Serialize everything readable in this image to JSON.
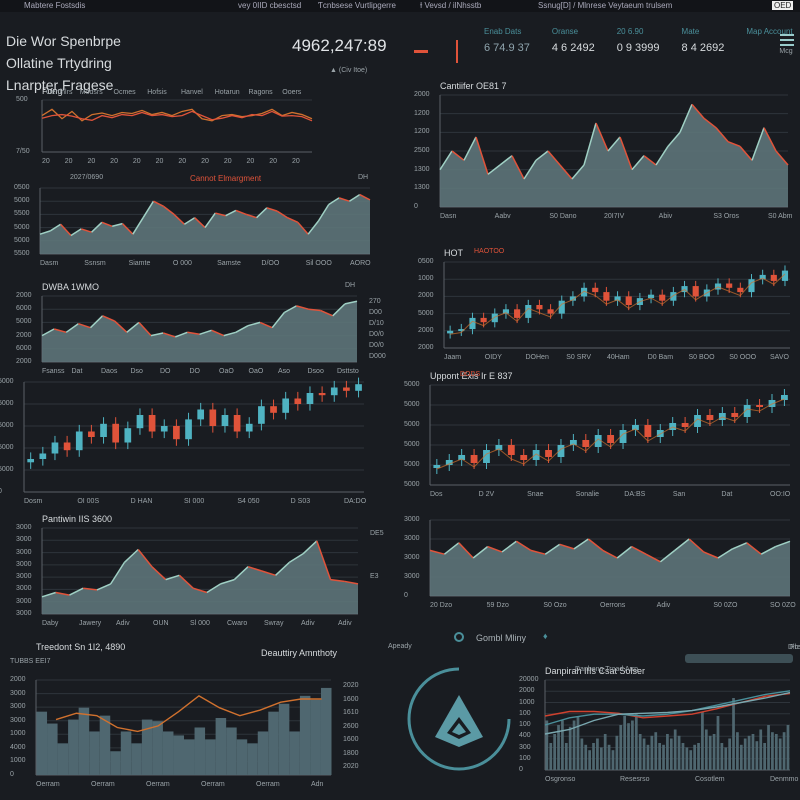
{
  "topbar": {
    "items": [
      "Mabtere Fostsdis",
      "vey 0IID cbesctsd",
      "Ƭcnbsese Vurtlipgerre",
      "Ɨ Vevsd / ilNhsstb",
      "Ssnug[D] / Mlnrese Veytaeum trulsem",
      "OED"
    ]
  },
  "header": {
    "line1": "Die Wor Spenbrpe",
    "line2": "Ollatine Trtydring",
    "line3": "Lnarpter Fragese",
    "big_value": "4962,247:89",
    "badge": "(Civ Itoe)"
  },
  "stats": {
    "items": [
      {
        "label": "Enab Dats",
        "value": "6 74.9 37"
      },
      {
        "label": "Oranse",
        "value": "4 6 2492"
      },
      {
        "label": "20 6.90",
        "value": "0 9 3999"
      },
      {
        "label": "Mate",
        "value": "8 4 2692"
      },
      {
        "label": "Map Account",
        "value": "Mcg"
      }
    ]
  },
  "colors": {
    "bg": "#191c21",
    "area": "#5d7479",
    "red": "#e0533a",
    "orange": "#d0712e",
    "teal": "#4fb3c2"
  },
  "chart_data": [
    {
      "id": "A",
      "type": "line",
      "title": "Fong",
      "header": [
        "Oertlhlrs",
        "Modsrs",
        "Ocmes",
        "Hofsis",
        "Hanvel",
        "Hotarun",
        "Ragons",
        "Ooers"
      ],
      "yticks": [
        "500",
        "7/50"
      ],
      "xticks": [
        "20",
        "20",
        "20",
        "20",
        "20",
        "20",
        "20",
        "20",
        "20",
        "20",
        "20",
        "20"
      ],
      "ylim": [
        0,
        1000
      ],
      "series": [
        {
          "name": "a",
          "color": "#d0712e",
          "values": [
            700,
            820,
            640,
            780,
            600,
            720,
            750,
            700,
            760,
            740,
            800,
            720,
            760,
            700,
            780,
            820,
            640,
            600,
            700,
            720,
            680,
            700,
            740,
            820,
            700,
            760,
            720,
            640
          ]
        },
        {
          "name": "b",
          "color": "#e0533a",
          "values": [
            650,
            700,
            720,
            690,
            640,
            610,
            700,
            660,
            720,
            700,
            760,
            700,
            720,
            680,
            700,
            780,
            700,
            620,
            650,
            700,
            660,
            720,
            700,
            780,
            690,
            700,
            680,
            600
          ]
        }
      ]
    },
    {
      "id": "B",
      "type": "area",
      "title": "Cannot Elmargment",
      "subtitle": "2027/0690",
      "legend": "DH",
      "yticks": [
        "0500",
        "5000",
        "5500",
        "5000",
        "5000",
        "5500"
      ],
      "xticks": [
        "Dasm",
        "Ssnsm",
        "Siamte",
        "O 000",
        "Samste",
        "D/OO",
        "Sil OOO",
        "AORO"
      ],
      "ylim": [
        0,
        100
      ],
      "values": [
        30,
        35,
        45,
        28,
        38,
        33,
        48,
        42,
        46,
        30,
        55,
        80,
        72,
        60,
        45,
        55,
        40,
        62,
        58,
        66,
        60,
        55,
        70,
        65,
        55,
        48,
        30,
        50,
        75,
        85,
        80,
        90,
        82
      ]
    },
    {
      "id": "C",
      "type": "area",
      "title": "DWBA 1WMO",
      "legend": "DH",
      "yticks": [
        "2000",
        "6000",
        "5000",
        "2000",
        "6000",
        "2000"
      ],
      "xticks": [
        "Fsanss",
        "Dat",
        "Daos",
        "Dso",
        "DO",
        "DO",
        "OaO",
        "OaO",
        "Aso",
        "Dsoo",
        "Dsttsto"
      ],
      "side": [
        "270",
        "D00",
        "D/10",
        "D0/0",
        "D0/0",
        "D000"
      ],
      "ylim": [
        0,
        100
      ],
      "values": [
        40,
        50,
        45,
        58,
        52,
        70,
        62,
        45,
        60,
        40,
        44,
        38,
        45,
        42,
        48,
        40,
        45,
        55,
        60,
        52,
        75,
        85,
        80,
        78,
        70,
        88,
        92
      ]
    },
    {
      "id": "D",
      "type": "candle",
      "yticks": [
        "5000",
        "5000",
        "5000",
        "5000",
        "5000",
        "0"
      ],
      "xticks": [
        "Dosm",
        "OI 00S",
        "D HAN",
        "SI 000",
        "S4 050",
        "D S03",
        "DA:DO"
      ],
      "ylim": [
        0,
        100
      ],
      "values": [
        30,
        35,
        45,
        38,
        55,
        50,
        62,
        45,
        58,
        70,
        55,
        60,
        48,
        66,
        75,
        60,
        70,
        55,
        62,
        78,
        72,
        85,
        80,
        90,
        88,
        95,
        92,
        98
      ]
    },
    {
      "id": "E",
      "type": "area",
      "title": "Pantiwin IIS 3600",
      "yticks": [
        "3000",
        "3000",
        "3000",
        "3000",
        "3000",
        "3000",
        "3000",
        "3000"
      ],
      "xticks": [
        "Daby",
        "Jawery",
        "Adiv",
        "OUN",
        "Sl 000",
        "Cwaro",
        "Swray",
        "Adiv",
        "Adiv"
      ],
      "side": [
        "DE5",
        "E3"
      ],
      "ylim": [
        0,
        100
      ],
      "values": [
        20,
        25,
        22,
        30,
        28,
        35,
        60,
        75,
        55,
        40,
        45,
        30,
        25,
        35,
        40,
        55,
        50,
        45,
        60,
        70,
        85,
        40,
        38,
        35
      ]
    },
    {
      "id": "F",
      "type": "bars-line",
      "title": "Treedont Sn 1I2, 4890",
      "subtitle": "TUBBS EEI7",
      "legend": "Deauttiry Amnthoty",
      "yticks": [
        "2000",
        "3000",
        "3000",
        "3000",
        "1000",
        "4000",
        "1000",
        "0"
      ],
      "side": [
        "2020",
        "1600",
        "1610",
        "2600",
        "1600",
        "1800",
        "2020"
      ],
      "xticks": [
        "Oerram",
        "Oerram",
        "Oerram",
        "Oerram",
        "Oerram",
        "Adn"
      ],
      "ylim": [
        0,
        120
      ],
      "values": [
        80,
        65,
        40,
        70,
        85,
        55,
        75,
        30,
        55,
        40,
        70,
        68,
        55,
        50,
        45,
        60,
        45,
        72,
        60,
        45,
        40,
        55,
        80,
        90,
        55,
        100,
        95,
        110
      ],
      "line": [
        70,
        78,
        75,
        60,
        55,
        62,
        80,
        100,
        85,
        75,
        82,
        92,
        96,
        96
      ]
    },
    {
      "id": "G",
      "type": "area",
      "title": "Cantiifer OE81 7",
      "yticks": [
        "2000",
        "1200",
        "1200",
        "2500",
        "1300",
        "1300",
        "0"
      ],
      "xticks": [
        "Dasn",
        "Aabv",
        "S0 Dano",
        "20I7IV",
        "Abiv",
        "S3 Oros",
        "S0 Abm"
      ],
      "ylim": [
        0,
        120
      ],
      "values": [
        40,
        60,
        50,
        75,
        35,
        45,
        55,
        30,
        50,
        60,
        45,
        30,
        45,
        90,
        60,
        75,
        40,
        55,
        45,
        65,
        80,
        110,
        95,
        85,
        70,
        65,
        50,
        85,
        60,
        45
      ]
    },
    {
      "id": "H",
      "type": "candle",
      "title": "HOT",
      "subtitle": "HAOTOO",
      "yticks": [
        "0500",
        "1000",
        "2000",
        "5000",
        "2000",
        "2000"
      ],
      "xticks": [
        "Jaam",
        "OIDY",
        "DOHen",
        "S0 SRV",
        "40Ham",
        "D0 Bam",
        "S0 BOO",
        "S0 OOO",
        "SAVO"
      ],
      "ylim": [
        0,
        100
      ],
      "values": [
        20,
        22,
        35,
        30,
        40,
        45,
        35,
        50,
        45,
        40,
        55,
        60,
        70,
        65,
        55,
        60,
        50,
        58,
        62,
        55,
        65,
        72,
        60,
        68,
        75,
        70,
        65,
        80,
        85,
        78,
        90
      ]
    },
    {
      "id": "I",
      "type": "candle",
      "title": "Uppont Exis Ir E 837",
      "subtitle": "DODS",
      "yticks": [
        "5000",
        "5000",
        "5000",
        "5000",
        "5000",
        "5000"
      ],
      "xticks": [
        "Dos",
        "D 2V",
        "Snae",
        "Sonalie",
        "DA:BS",
        "San",
        "Dat",
        "OO:IO"
      ],
      "ylim": [
        0,
        100
      ],
      "values": [
        20,
        25,
        30,
        22,
        35,
        40,
        30,
        25,
        35,
        28,
        40,
        45,
        38,
        50,
        42,
        55,
        60,
        48,
        55,
        62,
        58,
        70,
        65,
        72,
        68,
        80,
        78,
        85,
        90
      ]
    },
    {
      "id": "J",
      "type": "area",
      "yticks": [
        "3000",
        "3000",
        "3000",
        "3000",
        "0"
      ],
      "xticks": [
        "20 Dzo",
        "59 Dzo",
        "S0 Ozo",
        "Oerrons",
        "Adiv",
        "S0 0ZO",
        "SO 0ZO"
      ],
      "ylim": [
        0,
        100
      ],
      "values": [
        60,
        55,
        70,
        50,
        65,
        58,
        72,
        60,
        55,
        68,
        62,
        75,
        60,
        50,
        65,
        55,
        45,
        60,
        75,
        58,
        50,
        62,
        70,
        55,
        65,
        72
      ]
    },
    {
      "id": "K",
      "type": "bars-lines",
      "title": "Danpirah IIIs Csat Solser",
      "subtitle": "Danbeng Troad Arrp",
      "legend": "Pressoray",
      "legend_value": "Dib",
      "slider_value": "OB",
      "yticks": [
        "20000",
        "2000",
        "1000",
        "100",
        "100",
        "400",
        "300",
        "100",
        "0"
      ],
      "xticks": [
        "Osgronso",
        "Resesrso",
        "Cosotlem",
        "Denmmo"
      ],
      "ylim": [
        0,
        100
      ],
      "values": [
        55,
        30,
        40,
        50,
        55,
        30,
        48,
        55,
        60,
        35,
        28,
        22,
        30,
        35,
        25,
        40,
        28,
        22,
        38,
        50,
        60,
        52,
        55,
        62,
        40,
        35,
        28,
        38,
        42,
        30,
        28,
        40,
        35,
        45,
        38,
        30,
        25,
        22,
        28,
        30,
        65,
        45,
        38,
        40,
        60,
        30,
        25,
        35,
        80,
        42,
        28,
        35,
        38,
        40,
        32,
        45,
        30,
        50,
        42,
        40,
        35,
        42,
        50
      ],
      "lines": [
        {
          "color": "#d0412e",
          "values": [
            60,
            65,
            65,
            63,
            58,
            60,
            62,
            68,
            75,
            82,
            85
          ]
        },
        {
          "color": "#4a8f9a",
          "values": [
            50,
            58,
            62,
            62,
            60,
            62,
            66,
            72,
            78,
            84,
            88
          ]
        },
        {
          "color": "#7aa8b0",
          "values": [
            40,
            45,
            55,
            62,
            63,
            64,
            66,
            70,
            75,
            80,
            86
          ]
        }
      ]
    }
  ],
  "widgets": {
    "logo_title": "Gombl Mliny",
    "left_caption": "Apeady"
  }
}
